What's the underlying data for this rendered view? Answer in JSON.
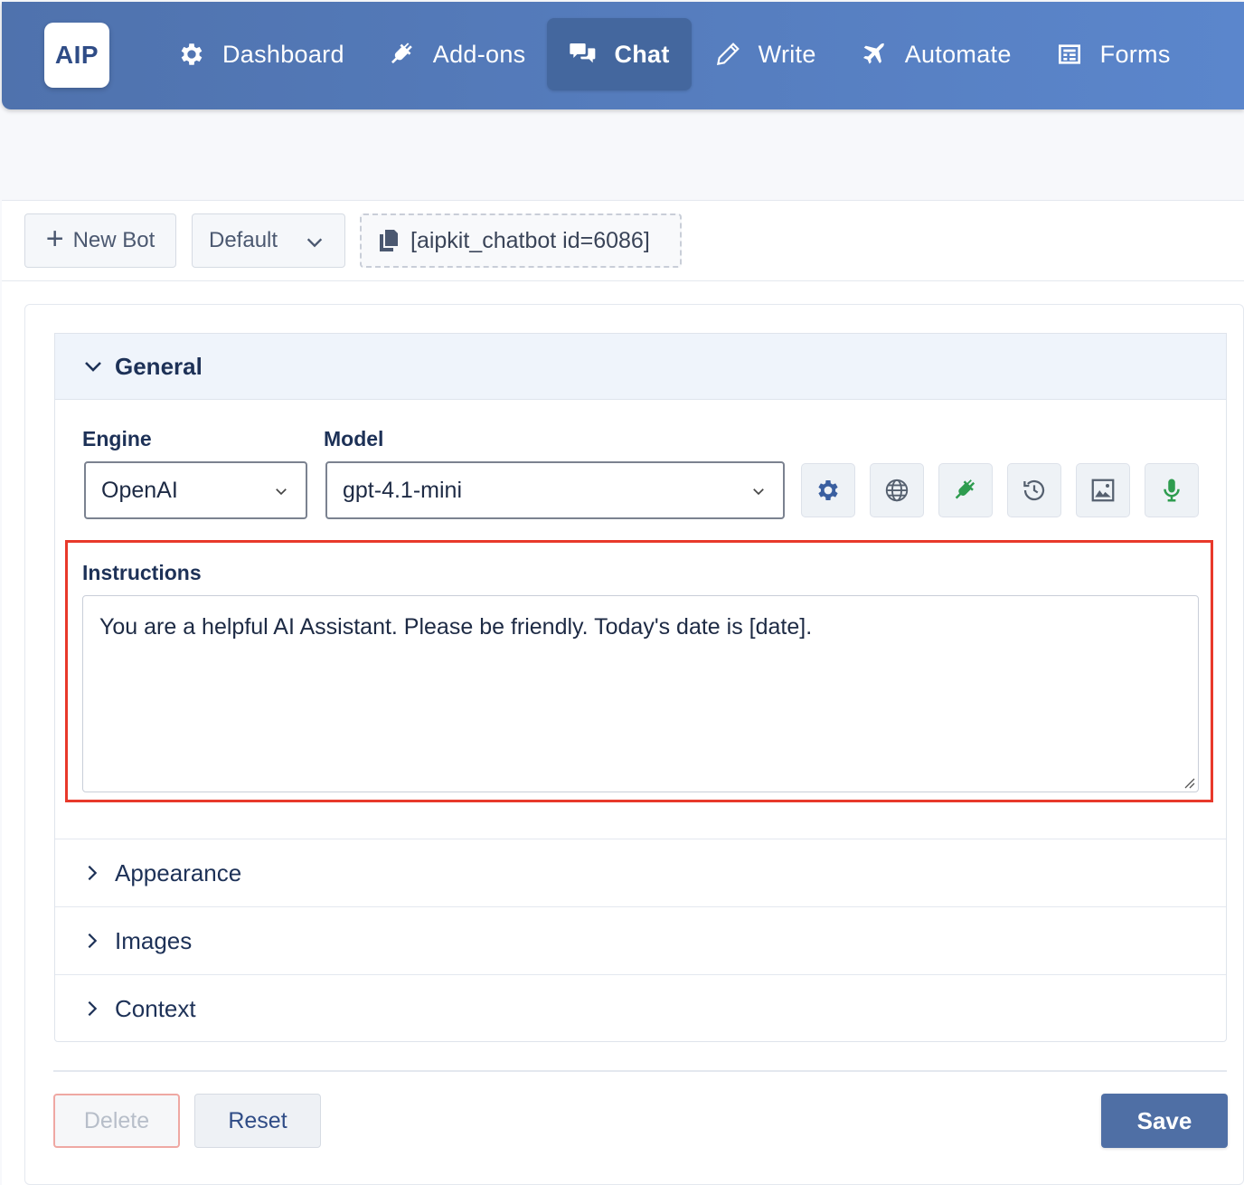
{
  "logo": {
    "text": "AIP"
  },
  "nav": {
    "items": [
      {
        "label": "Dashboard",
        "icon": "gear-icon"
      },
      {
        "label": "Add-ons",
        "icon": "plug-icon"
      },
      {
        "label": "Chat",
        "icon": "chat-bubbles-icon",
        "active": true
      },
      {
        "label": "Write",
        "icon": "pencil-icon"
      },
      {
        "label": "Automate",
        "icon": "plane-icon"
      },
      {
        "label": "Forms",
        "icon": "form-icon"
      }
    ]
  },
  "toolbar": {
    "new_bot_label": "New Bot",
    "bot_select_value": "Default",
    "shortcode": "[aipkit_chatbot id=6086]"
  },
  "general": {
    "title": "General",
    "engine": {
      "label": "Engine",
      "value": "OpenAI"
    },
    "model": {
      "label": "Model",
      "value": "gpt-4.1-mini"
    },
    "tool_icons": [
      "gear-icon",
      "globe-icon",
      "plug-icon",
      "history-icon",
      "image-icon",
      "microphone-icon"
    ],
    "instructions": {
      "label": "Instructions",
      "value": "You are a helpful AI Assistant. Please be friendly. Today's date is [date]."
    }
  },
  "sections": [
    {
      "title": "Appearance"
    },
    {
      "title": "Images"
    },
    {
      "title": "Context"
    }
  ],
  "footer": {
    "delete_label": "Delete",
    "reset_label": "Reset",
    "save_label": "Save"
  },
  "colors": {
    "nav_gradient_start": "#4f72ad",
    "nav_gradient_end": "#5b86cc",
    "primary": "#4f6fa5",
    "highlight_red": "#e8392b",
    "plug_green": "#2e9c4f"
  }
}
